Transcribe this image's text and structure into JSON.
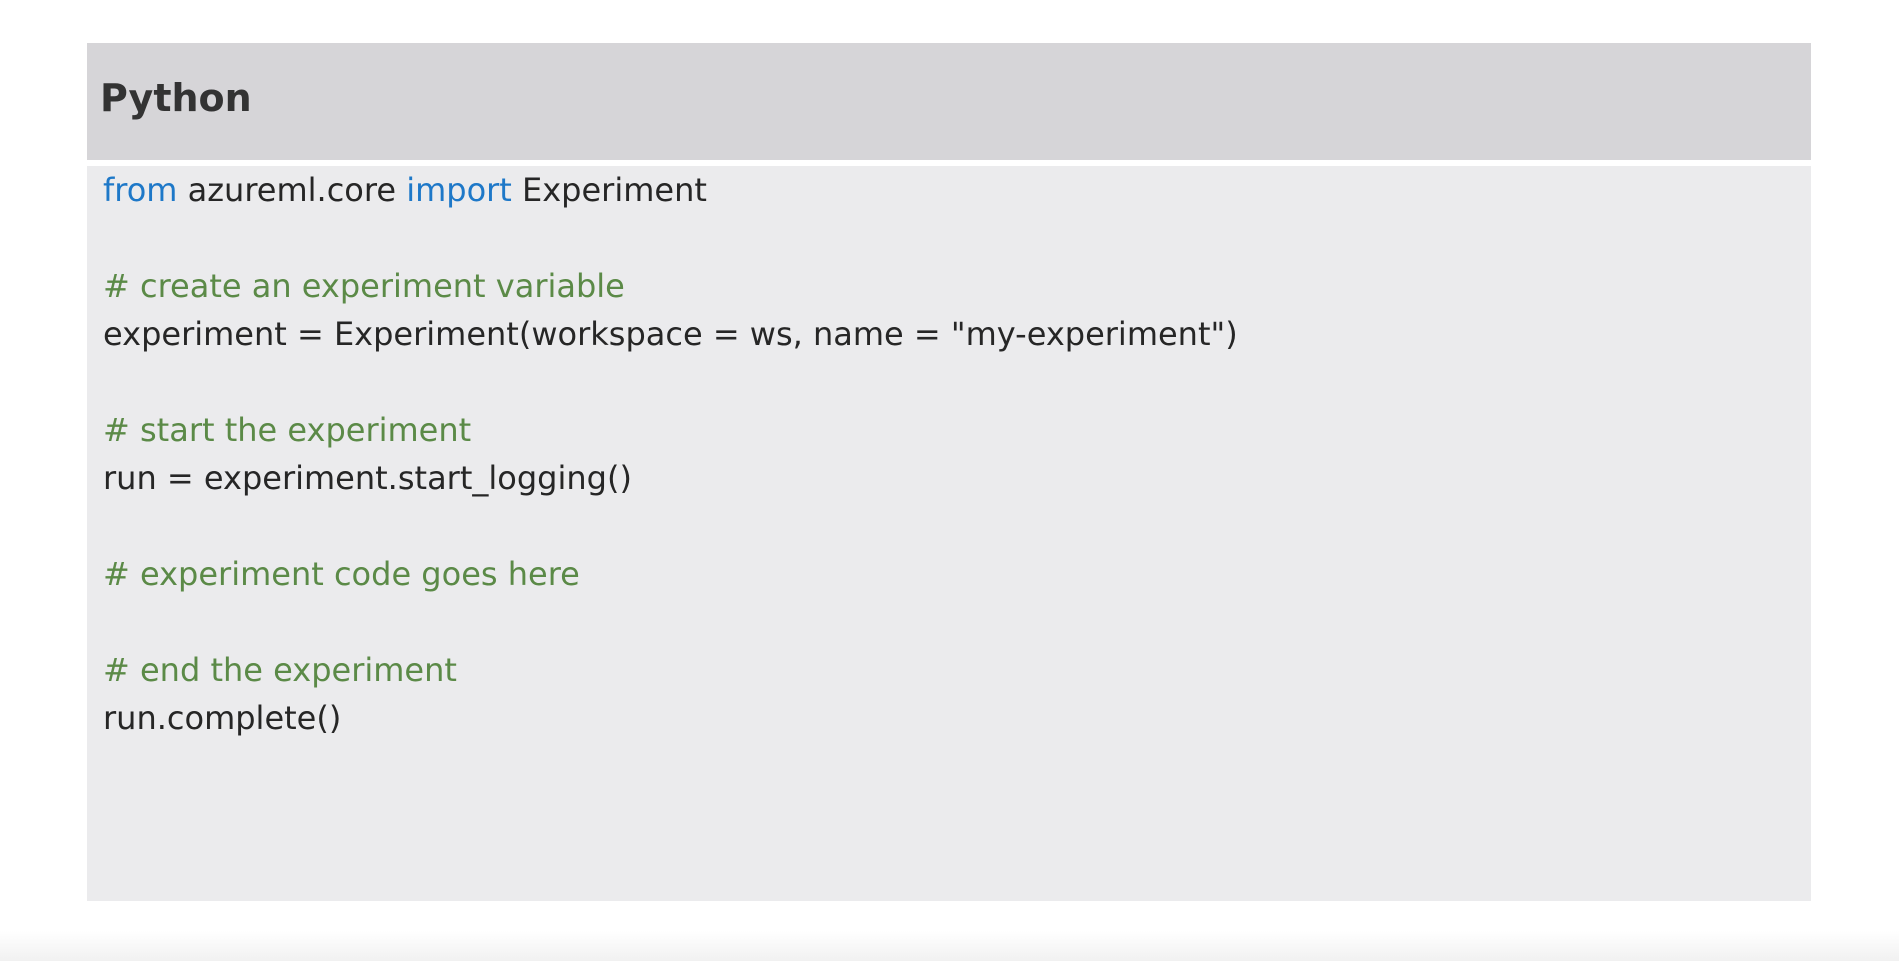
{
  "panel": {
    "title": "Python",
    "background": "#ebebed",
    "header_background": "#d6d5d8"
  },
  "colors": {
    "keyword": "#1e78c8",
    "comment": "#5b8a47",
    "text": "#262626"
  },
  "code": {
    "line1": {
      "kw1": "from",
      "t1": " azureml.core ",
      "kw2": "import",
      "t2": " Experiment"
    },
    "line2": "",
    "line3": "# create an experiment variable",
    "line4": "experiment = Experiment(workspace = ws, name = \"my-experiment\")",
    "line5": "",
    "line6": "# start the experiment",
    "line7": "run = experiment.start_logging()",
    "line8": "",
    "line9": "# experiment code goes here",
    "line10": "",
    "line11": "# end the experiment",
    "line12": "run.complete()"
  }
}
